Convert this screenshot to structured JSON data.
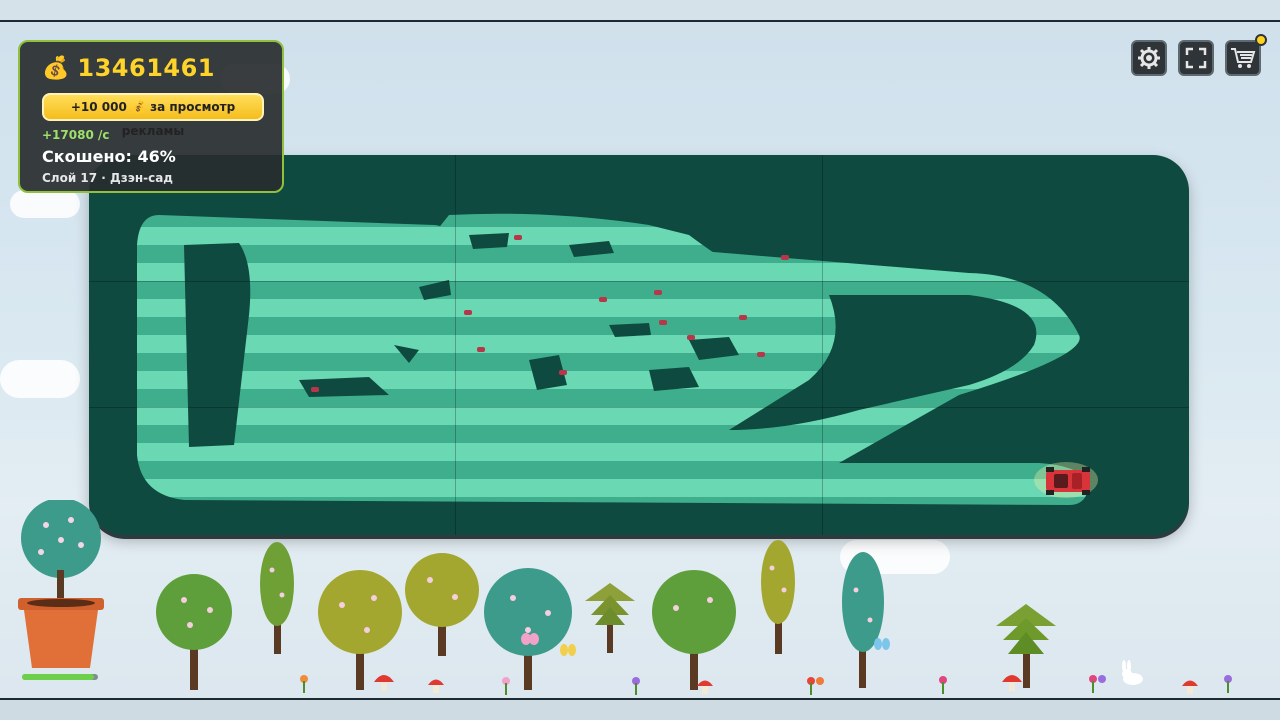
{
  "hud": {
    "money_icon": "money-bag-icon",
    "money": "13461461",
    "ad_button_label": "+10 000 💰 за просмотр рекламы",
    "income_rate": "+17080 /с",
    "mowed_label": "Скошено: 46%",
    "layer_label": "Слой 17 · Дзэн-сад"
  },
  "toolbar": {
    "settings_icon": "gear-icon",
    "fullscreen_icon": "fullscreen-icon",
    "shop_icon": "shopping-cart-icon",
    "shop_has_notification": true
  },
  "field": {
    "mowed_fraction": 0.46,
    "grass_color": "#0e4a3f",
    "cut_stripe_light": "#6ad8b2",
    "cut_stripe_dark": "#3fae8c",
    "mower_color": "#d9343a"
  },
  "pot_plant": {
    "growth_progress": 0.95
  },
  "colors": {
    "money": "#ffd42a",
    "income": "#9fe06b",
    "hud_border": "#8fc13d"
  }
}
